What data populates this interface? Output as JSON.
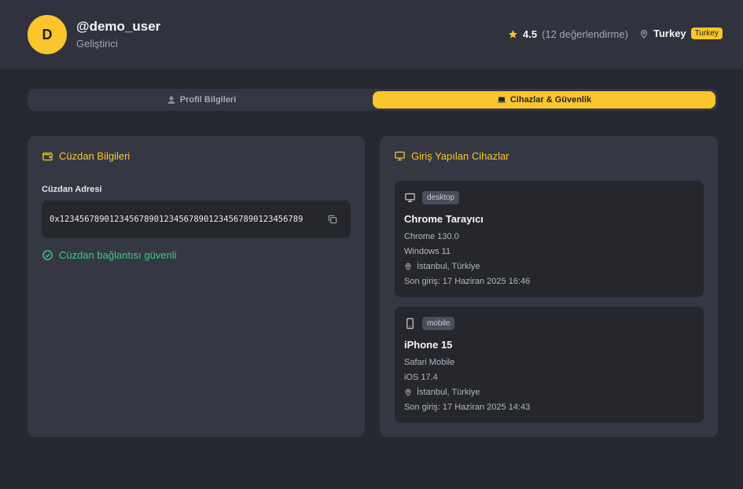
{
  "profile": {
    "avatar_initial": "D",
    "username": "@demo_user",
    "role": "Geliştirici",
    "rating": "4.5",
    "rating_count": "(12 değerlendirme)",
    "location": "Turkey",
    "country_badge": "Turkey"
  },
  "tabs": [
    {
      "label": "Profil Bilgileri",
      "icon": "user-icon",
      "active": false
    },
    {
      "label": "Cihazlar & Güvenlik",
      "icon": "laptop-icon",
      "active": true
    }
  ],
  "wallet": {
    "title": "Cüzdan Bilgileri",
    "address_label": "Cüzdan Adresi",
    "address": "0x1234567890123456789012345678901234567890123456789",
    "status": "Cüzdan bağlantısı güvenli"
  },
  "devices": {
    "title": "Giriş Yapılan Cihazlar",
    "items": [
      {
        "type": "desktop",
        "name": "Chrome Tarayıcı",
        "browser": "Chrome 130.0",
        "os": "Windows 11",
        "location": "İstanbul, Türkiye",
        "last_login": "Son giriş: 17 Haziran 2025 16:46"
      },
      {
        "type": "mobile",
        "name": "iPhone 15",
        "browser": "Safari Mobile",
        "os": "iOS 17.4",
        "location": "İstanbul, Türkiye",
        "last_login": "Son giriş: 17 Haziran 2025 14:43"
      }
    ]
  },
  "colors": {
    "accent": "#fbc52d",
    "success": "#35d07f",
    "background": "#262830",
    "card": "#353842"
  }
}
